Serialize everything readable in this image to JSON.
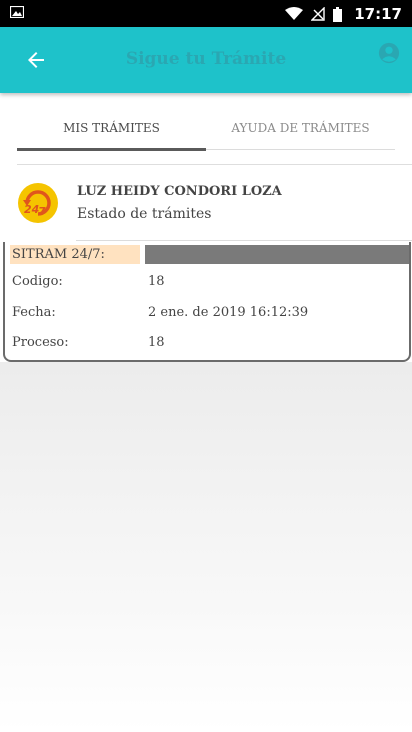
{
  "status_bar": {
    "time": "17:17",
    "icons": [
      "image-icon",
      "wifi-icon",
      "no-signal-icon",
      "battery-icon"
    ]
  },
  "app_bar": {
    "title": "Sigue tu Trámite",
    "back_icon": "arrow-back-icon",
    "account_icon": "account-circle-icon",
    "color": "#1ec2ca"
  },
  "tabs": [
    {
      "label": "MIS TRÁMITES",
      "active": true
    },
    {
      "label": "AYUDA DE TRÁMITES",
      "active": false
    }
  ],
  "header": {
    "name": "LUZ HEIDY CONDORI LOZA",
    "subtitle": "Estado de trámites",
    "logo": "sitram-24-7-logo"
  },
  "card": {
    "label": "SITRAM 24/7:",
    "rows": [
      {
        "key": "Codigo:",
        "value": "18"
      },
      {
        "key": "Fecha:",
        "value": "2 ene. de 2019 16:12:39"
      },
      {
        "key": "Proceso:",
        "value": "18"
      }
    ]
  }
}
